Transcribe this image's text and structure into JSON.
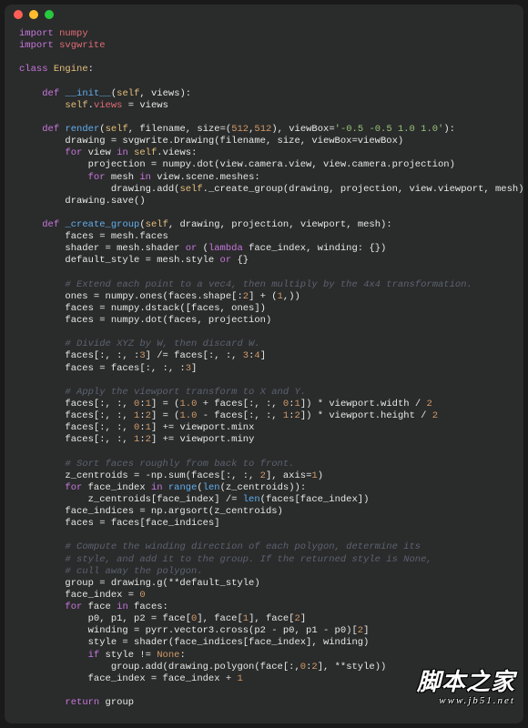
{
  "titlebar": {
    "red": "close-icon",
    "yellow": "minimize-icon",
    "green": "zoom-icon"
  },
  "code": {
    "l1a": "import",
    "l1b": "numpy",
    "l2a": "import",
    "l2b": "svgwrite",
    "l3a": "class",
    "l3b": "Engine",
    "l3c": ":",
    "l4a": "def",
    "l4b": "__init__",
    "l4c": "(",
    "l4d": "self",
    "l4e": ", views):",
    "l5a": "self",
    "l5b": ".",
    "l5c": "views",
    "l5d": " = views",
    "l6a": "def",
    "l6b": "render",
    "l6c": "(",
    "l6d": "self",
    "l6e": ", filename, size=(",
    "l6f": "512",
    "l6g": ",",
    "l6h": "512",
    "l6i": "), viewBox=",
    "l6j": "'-0.5 -0.5 1.0 1.0'",
    "l6k": "):",
    "l7": "        drawing = svgwrite.Drawing(filename, size, viewBox=viewBox)",
    "l8a": "for",
    "l8b": " view ",
    "l8c": "in",
    "l8d": " ",
    "l8e": "self",
    "l8f": ".views:",
    "l9": "            projection = numpy.dot(view.camera.view, view.camera.projection)",
    "l10a": "for",
    "l10b": " mesh ",
    "l10c": "in",
    "l10d": " view.scene.meshes:",
    "l11a": "                drawing.add(",
    "l11b": "self",
    "l11c": "._create_group(drawing, projection, view.viewport, mesh))",
    "l12": "        drawing.save()",
    "l13a": "def",
    "l13b": "_create_group",
    "l13c": "(",
    "l13d": "self",
    "l13e": ", drawing, projection, viewport, mesh):",
    "l14": "        faces = mesh.faces",
    "l15a": "        shader = mesh.shader ",
    "l15b": "or",
    "l15c": " (",
    "l15d": "lambda",
    "l15e": " face_index, winding: {})",
    "l16a": "        default_style = mesh.style ",
    "l16b": "or",
    "l16c": " {}",
    "c1": "# Extend each point to a vec4, then multiply by the 4x4 transformation.",
    "l17a": "        ones = numpy.ones(faces.shape[:",
    "l17b": "2",
    "l17c": "] + (",
    "l17d": "1",
    "l17e": ",))",
    "l18": "        faces = numpy.dstack([faces, ones])",
    "l19": "        faces = numpy.dot(faces, projection)",
    "c2": "# Divide XYZ by W, then discard W.",
    "l20a": "        faces[:, :, :",
    "l20b": "3",
    "l20c": "] /= faces[:, :, ",
    "l20d": "3",
    "l20e": ":",
    "l20f": "4",
    "l20g": "]",
    "l21a": "        faces = faces[:, :, :",
    "l21b": "3",
    "l21c": "]",
    "c3": "# Apply the viewport transform to X and Y.",
    "l22a": "        faces[:, :, ",
    "l22b": "0",
    "l22c": ":",
    "l22d": "1",
    "l22e": "] = (",
    "l22f": "1.0",
    "l22g": " + faces[:, :, ",
    "l22h": "0",
    "l22i": ":",
    "l22j": "1",
    "l22k": "]) * viewport.width / ",
    "l22l": "2",
    "l23a": "        faces[:, :, ",
    "l23b": "1",
    "l23c": ":",
    "l23d": "2",
    "l23e": "] = (",
    "l23f": "1.0",
    "l23g": " - faces[:, :, ",
    "l23h": "1",
    "l23i": ":",
    "l23j": "2",
    "l23k": "]) * viewport.height / ",
    "l23l": "2",
    "l24a": "        faces[:, :, ",
    "l24b": "0",
    "l24c": ":",
    "l24d": "1",
    "l24e": "] += viewport.minx",
    "l25a": "        faces[:, :, ",
    "l25b": "1",
    "l25c": ":",
    "l25d": "2",
    "l25e": "] += viewport.miny",
    "c4": "# Sort faces roughly from back to front.",
    "l26a": "        z_centroids = -np.sum(faces[:, :, ",
    "l26b": "2",
    "l26c": "], axis=",
    "l26d": "1",
    "l26e": ")",
    "l27a": "for",
    "l27b": " face_index ",
    "l27c": "in",
    "l27d": " ",
    "l27e": "range",
    "l27f": "(",
    "l27g": "len",
    "l27h": "(z_centroids)):",
    "l28a": "            z_centroids[face_index] /= ",
    "l28b": "len",
    "l28c": "(faces[face_index])",
    "l29": "        face_indices = np.argsort(z_centroids)",
    "l30": "        faces = faces[face_indices]",
    "c5": "# Compute the winding direction of each polygon, determine its",
    "c6": "# style, and add it to the group. If the returned style is None,",
    "c7": "# cull away the polygon.",
    "l31": "        group = drawing.g(**default_style)",
    "l32a": "        face_index = ",
    "l32b": "0",
    "l33a": "for",
    "l33b": " face ",
    "l33c": "in",
    "l33d": " faces:",
    "l34a": "            p0, p1, p2 = face[",
    "l34b": "0",
    "l34c": "], face[",
    "l34d": "1",
    "l34e": "], face[",
    "l34f": "2",
    "l34g": "]",
    "l35a": "            winding = pyrr.vector3.cross(p2 - p0, p1 - p0)[",
    "l35b": "2",
    "l35c": "]",
    "l36": "            style = shader(face_indices[face_index], winding)",
    "l37a": "if",
    "l37b": " style != ",
    "l37c": "None",
    "l37d": ":",
    "l38a": "                group.add(drawing.polygon(face[:,",
    "l38b": "0",
    "l38c": ":",
    "l38d": "2",
    "l38e": "], **style))",
    "l39a": "            face_index = face_index + ",
    "l39b": "1",
    "l40a": "return",
    "l40b": " group"
  },
  "watermark": {
    "cn": "脚本之家",
    "url": "www.jb51.net"
  }
}
